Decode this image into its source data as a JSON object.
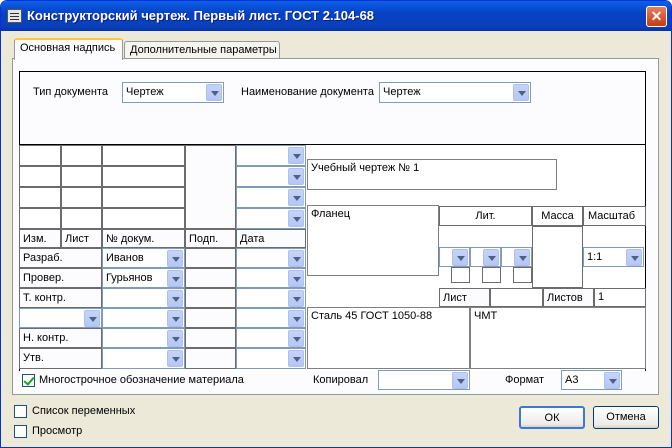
{
  "window": {
    "title": "Конструкторский чертеж. Первый лист. ГОСТ 2.104-68",
    "close_glyph": "✕"
  },
  "tabs": [
    {
      "label": "Основная надпись",
      "active": true
    },
    {
      "label": "Дополнительные параметры",
      "active": false
    }
  ],
  "top": {
    "doc_type_label": "Тип документа",
    "doc_type_value": "Чертеж",
    "doc_name_label": "Наименование документа",
    "doc_name_value": "Чертеж"
  },
  "stamp": {
    "designation": "Учебный чертеж № 1",
    "name": "Фланец",
    "material": "Сталь 45 ГОСТ 1050-88",
    "organization": "ЧМТ",
    "columns": {
      "izm": "Изм.",
      "list": "Лист",
      "ndoc": "№ докум.",
      "podp": "Подп.",
      "date": "Дата"
    },
    "roles": [
      {
        "role": "Разраб.",
        "name": "Иванов"
      },
      {
        "role": "Провер.",
        "name": "Гурьянов"
      },
      {
        "role": "Т. контр.",
        "name": ""
      },
      {
        "role": "",
        "name": ""
      },
      {
        "role": "Н. контр.",
        "name": ""
      },
      {
        "role": "Утв.",
        "name": ""
      }
    ],
    "lit_label": "Лит.",
    "mass_label": "Масса",
    "scale_label": "Масштаб",
    "scale_value": "1:1",
    "sheet_label": "Лист",
    "sheet_value": "",
    "sheets_label": "Листов",
    "sheets_value": "1"
  },
  "bottom": {
    "multiline_material_label": "Многострочное обозначение материала",
    "multiline_material_checked": true,
    "copied_label": "Копировал",
    "copied_value": "",
    "format_label": "Формат",
    "format_value": "А3"
  },
  "footer": {
    "variables_label": "Список переменных",
    "variables_checked": false,
    "preview_label": "Просмотр",
    "preview_checked": false,
    "ok_label": "ОК",
    "cancel_label": "Отмена"
  },
  "colors": {
    "title_bar": "#0842c5",
    "dialog_bg": "#ece9d8",
    "check_mark": "#21a121"
  }
}
